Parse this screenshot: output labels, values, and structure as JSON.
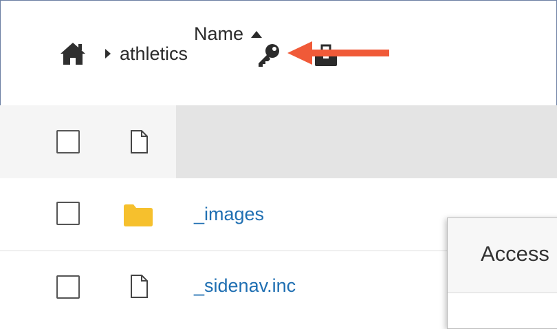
{
  "breadcrumb": {
    "current": "athletics"
  },
  "table": {
    "header": {
      "name_label": "Name"
    },
    "rows": [
      {
        "name": "_images",
        "type": "folder"
      },
      {
        "name": "_sidenav.inc",
        "type": "file"
      }
    ]
  },
  "popover": {
    "title": "Access"
  },
  "colors": {
    "link": "#1f6fb2",
    "folder": "#f6c02d",
    "arrow": "#f05a38",
    "header_bg": "#e4e4e4"
  },
  "icons": [
    "home-icon",
    "caret-right-icon",
    "key-icon",
    "briefcase-icon",
    "file-icon",
    "folder-icon",
    "sort-ascending-icon"
  ]
}
